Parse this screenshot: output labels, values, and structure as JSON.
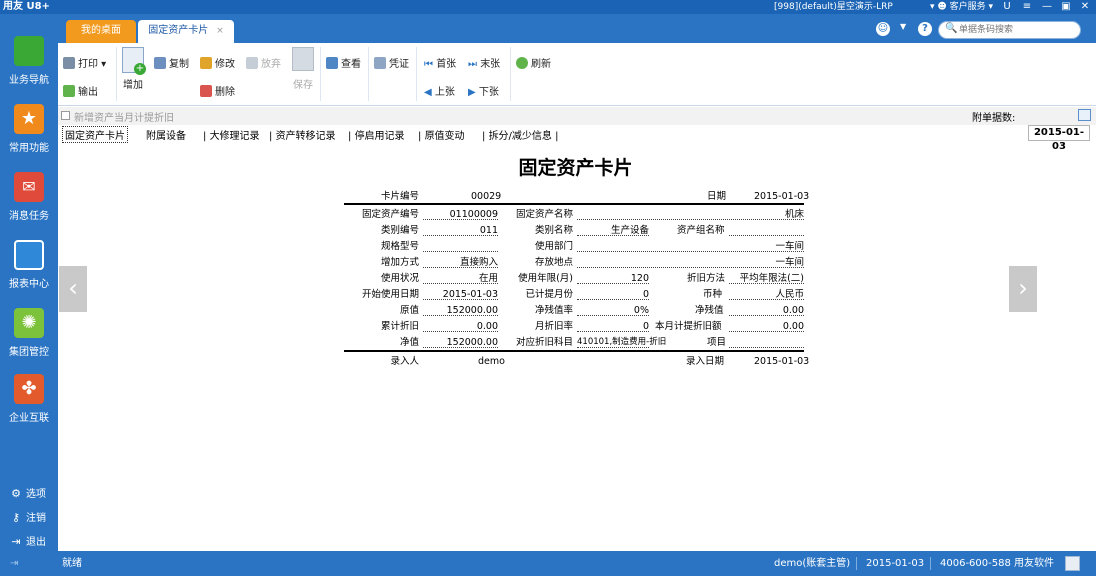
{
  "titlebar": {
    "logo": "用友 U8+",
    "info": "[998](default)星空演示-LRP",
    "service": "客户服务",
    "buttons": [
      "U",
      "≡",
      "—",
      "▣",
      "✕"
    ]
  },
  "leftnav": {
    "items": [
      {
        "label": "业务导航",
        "icon": "business-nav-icon",
        "color": "#3aa835"
      },
      {
        "label": "常用功能",
        "icon": "star-icon",
        "color": "#f08a1c"
      },
      {
        "label": "消息任务",
        "icon": "message-icon",
        "color": "#e04a3a"
      },
      {
        "label": "报表中心",
        "icon": "report-icon",
        "color": "#2f89d8"
      },
      {
        "label": "集团管控",
        "icon": "group-icon",
        "color": "#7cc23a"
      },
      {
        "label": "企业互联",
        "icon": "enterprise-icon",
        "color": "#e35a2d"
      }
    ],
    "bottom": [
      {
        "label": "选项",
        "icon": "⚙"
      },
      {
        "label": "注销",
        "icon": "🔑"
      },
      {
        "label": "退出",
        "icon": "⇥"
      }
    ]
  },
  "tabs": {
    "home": "我的桌面",
    "active": "固定资产卡片",
    "close": "×"
  },
  "search": {
    "placeholder": "单据条码搜索"
  },
  "toolbar": {
    "print": "打印",
    "output": "输出",
    "add": "增加",
    "copy": "复制",
    "modify": "修改",
    "discard": "放弃",
    "delete": "删除",
    "save": "保存",
    "view": "查看",
    "voucher": "凭证",
    "first": "首张",
    "last": "末张",
    "prev": "上张",
    "next": "下张",
    "refresh": "刷新"
  },
  "subbar": {
    "checkbox_label": "新增资产当月计提折旧",
    "attachments": "附单据数:"
  },
  "cardtabs": [
    "固定资产卡片",
    "附属设备",
    "大修理记录",
    "资产转移记录",
    "停启用记录",
    "原值变动",
    "拆分/减少信息"
  ],
  "date": "2015-01-03",
  "card": {
    "title": "固定资产卡片",
    "card_no_label": "卡片编号",
    "card_no": "00029",
    "date_label": "日期",
    "date": "2015-01-03",
    "asset_code_label": "固定资产编号",
    "asset_code": "01100009",
    "asset_name_label": "固定资产名称",
    "asset_name": "机床",
    "category_code_label": "类别编号",
    "category_code": "011",
    "category_name_label": "类别名称",
    "category_name": "生产设备",
    "asset_group_label": "资产组名称",
    "asset_group": "",
    "spec_label": "规格型号",
    "spec": "",
    "dept_label": "使用部门",
    "dept": "一车间",
    "add_method_label": "增加方式",
    "add_method": "直接购入",
    "location_label": "存放地点",
    "location": "一车间",
    "usage_status_label": "使用状况",
    "usage_status": "在用",
    "life_label": "使用年限(月)",
    "life": "120",
    "depr_method_label": "折旧方法",
    "depr_method": "平均年限法(二)",
    "start_date_label": "开始使用日期",
    "start_date": "2015-01-03",
    "months_label": "已计提月份",
    "months": "0",
    "currency_label": "币种",
    "currency": "人民币",
    "orig_value_label": "原值",
    "orig_value": "152000.00",
    "salvage_rate_label": "净残值率",
    "salvage_rate": "0%",
    "salvage_label": "净残值",
    "salvage": "0.00",
    "accum_depr_label": "累计折旧",
    "accum_depr": "0.00",
    "monthly_rate_label": "月折旧率",
    "monthly_rate": "0",
    "monthly_amount_label": "本月计提折旧额",
    "monthly_amount": "0.00",
    "net_value_label": "净值",
    "net_value": "152000.00",
    "depr_account_label": "对应折旧科目",
    "depr_account": "410101,制造费用-折旧",
    "project_label": "项目",
    "project": "",
    "entered_by_label": "录入人",
    "entered_by": "demo",
    "entered_date_label": "录入日期",
    "entered_date": "2015-01-03"
  },
  "status": {
    "ready": "就绪",
    "user": "demo(账套主管)",
    "date": "2015-01-03",
    "phone": "4006-600-588 用友软件"
  }
}
